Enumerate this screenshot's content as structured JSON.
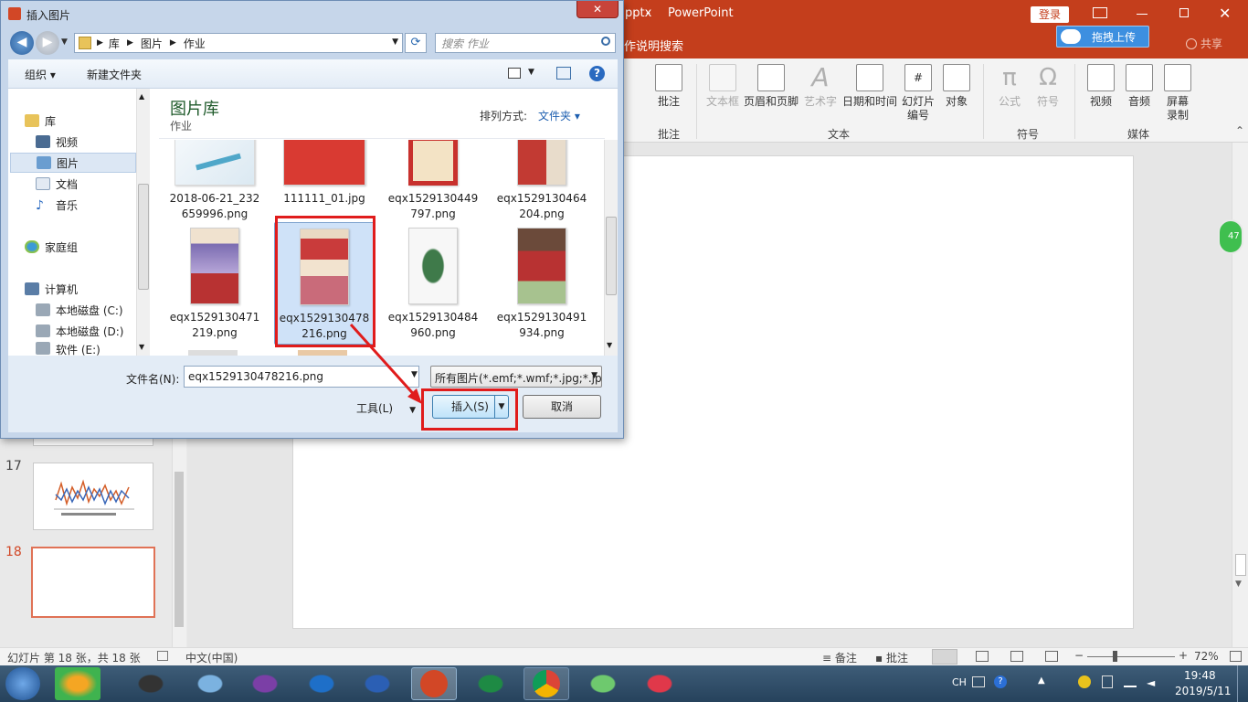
{
  "powerpoint": {
    "title_suffix": "pptx",
    "app_name": "PowerPoint",
    "login_label": "登录",
    "upload_label": "拖拽上传",
    "share_label": "共享",
    "tell_me": "作说明搜索",
    "ribbon": {
      "comment": {
        "label": "批注",
        "group": "批注"
      },
      "text_group": "文本",
      "text_items": [
        "文本框",
        "页眉和页脚",
        "艺术字",
        "日期和时间",
        "幻灯片\n编号",
        "对象"
      ],
      "symbol_group": "符号",
      "symbol_items": [
        "公式",
        "符号"
      ],
      "media_group": "媒体",
      "media_items": [
        "视频",
        "音频",
        "屏幕\n录制"
      ],
      "side_badge": "47"
    },
    "slides": [
      {
        "number": "17"
      },
      {
        "number": "18"
      }
    ],
    "status": {
      "slide_info": "幻灯片 第 18 张，共 18 张",
      "language": "中文(中国)",
      "notes": "备注",
      "comments": "批注",
      "zoom_minus": "−",
      "zoom_plus": "+",
      "zoom": "72%"
    },
    "taskbar": {
      "lang": "CH",
      "time": "19:48",
      "date": "2019/5/11"
    }
  },
  "dialog": {
    "title": "插入图片",
    "close": "✕",
    "breadcrumb": [
      "库",
      "图片",
      "作业"
    ],
    "search_placeholder": "搜索 作业",
    "toolbar": {
      "organize": "组织 ▾",
      "new_folder": "新建文件夹",
      "help": "?"
    },
    "nav": {
      "libraries": "库",
      "videos": "视频",
      "pictures": "图片",
      "documents": "文档",
      "music": "音乐",
      "homegroup": "家庭组",
      "computer": "计算机",
      "drive_c": "本地磁盘 (C:)",
      "drive_d": "本地磁盘 (D:)",
      "drive_e": "软件 (E:)"
    },
    "library_title": "图片库",
    "library_sub": "作业",
    "sort_label": "排列方式:",
    "sort_value": "文件夹 ▾",
    "files": [
      {
        "line1": "2018-06-21_232",
        "line2": "659996.png",
        "color": "#4fa7c9"
      },
      {
        "line1": "111111_01.jpg",
        "line2": "",
        "color": "#d93a32"
      },
      {
        "line1": "eqx1529130449",
        "line2": "797.png",
        "color": "#c8312d"
      },
      {
        "line1": "eqx1529130464",
        "line2": "204.png",
        "color": "#c23a33"
      },
      {
        "line1": "eqx1529130471",
        "line2": "219.png",
        "color": "#7a6bb0"
      },
      {
        "line1": "eqx1529130478",
        "line2": "216.png",
        "color": "#c93b3b"
      },
      {
        "line1": "eqx1529130484",
        "line2": "960.png",
        "color": "#3f7a4a"
      },
      {
        "line1": "eqx1529130491",
        "line2": "934.png",
        "color": "#b83232"
      }
    ],
    "filename_label": "文件名(N):",
    "filename_value": "eqx1529130478216.png",
    "filetype_value": "所有图片(*.emf;*.wmf;*.jpg;*.jp",
    "tools_label": "工具(L)",
    "insert_label": "插入(S)",
    "cancel_label": "取消"
  }
}
